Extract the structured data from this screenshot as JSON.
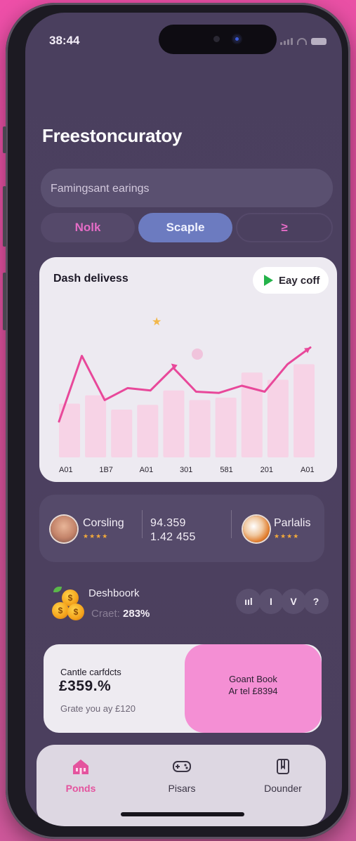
{
  "status": {
    "time": "38:44"
  },
  "app": {
    "title": "Freestoncuratoy"
  },
  "search": {
    "text": "Famingsant earings"
  },
  "tabs": [
    {
      "label": "Nolk",
      "active": false
    },
    {
      "label": "Scaple",
      "active": true
    },
    {
      "label": "≥",
      "active": false
    }
  ],
  "chart_card": {
    "title": "Dash delivess",
    "button_label": "Eay coff"
  },
  "chart_data": {
    "type": "line",
    "categories": [
      "A01",
      "1B7",
      "A01",
      "301",
      "581",
      "201",
      "A01"
    ],
    "series": [
      {
        "values": [
          3,
          8.5,
          4.8,
          5.8,
          5.6,
          7.5,
          5.5,
          5.4,
          6.0,
          5.5,
          7.8,
          9.2
        ]
      }
    ],
    "bars": [
      4.5,
      5.2,
      4.0,
      4.4,
      5.6,
      4.8,
      5.0,
      7.1,
      6.5,
      7.8
    ],
    "xlabel": "",
    "ylabel": "",
    "grid": false,
    "legend": "none",
    "line_color": "#e8489a",
    "bar_color": "#f7d3e6"
  },
  "profiles": {
    "left": {
      "name": "Corsling",
      "stars": "★★★★"
    },
    "stats": [
      "94.359",
      "1.42 455"
    ],
    "right": {
      "name": "Parlalis",
      "stars": "★★★★"
    }
  },
  "dashboard": {
    "title": "Deshboork",
    "subtitle_label": "Craet:",
    "subtitle_value": "283%",
    "chips": [
      "ııl",
      "I",
      "V",
      "?"
    ]
  },
  "promo": {
    "line1": "Cantle carfdcts",
    "amount": "£359.%",
    "line3": "Grate you ay £120",
    "right_line1": "Goant Book",
    "right_line2": "Ar tel £8394"
  },
  "nav": [
    {
      "label": "Ponds",
      "icon": "home-icon",
      "active": true
    },
    {
      "label": "Pisars",
      "icon": "gamepad-icon",
      "active": false
    },
    {
      "label": "Dounder",
      "icon": "document-icon",
      "active": false
    }
  ],
  "colors": {
    "accent": "#e4539e",
    "tab_active": "#6c7bc0",
    "promo_pink": "#f48fd4"
  }
}
